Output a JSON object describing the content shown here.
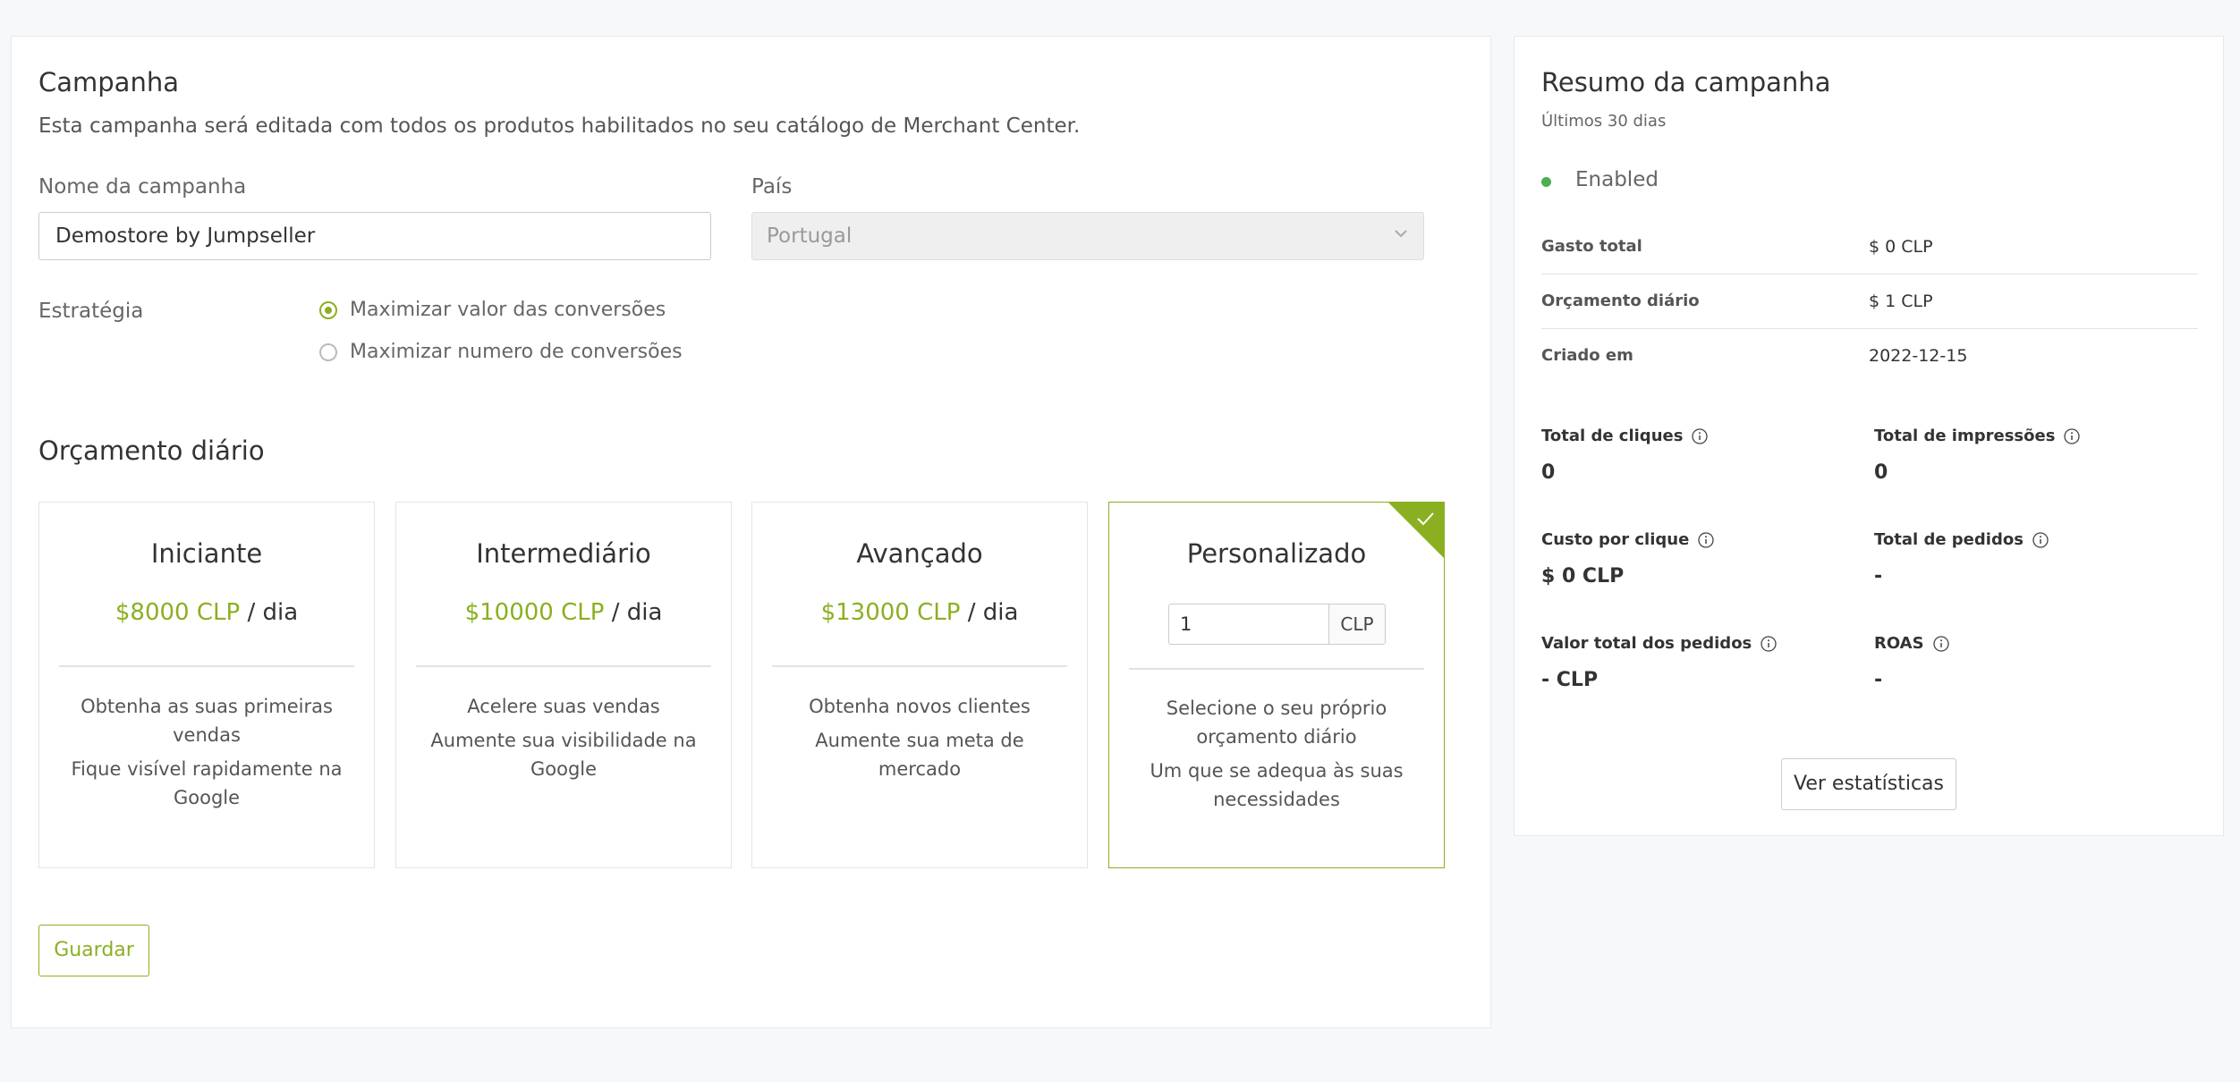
{
  "campaign": {
    "title": "Campanha",
    "description": "Esta campanha será editada com todos os produtos habilitados no seu catálogo de Merchant Center.",
    "name_label": "Nome da campanha",
    "name_value": "Demostore by Jumpseller",
    "country_label": "País",
    "country_value": "Portugal",
    "strategy_label": "Estratégia",
    "strategy_options": [
      {
        "label": "Maximizar valor das conversões",
        "selected": true
      },
      {
        "label": "Maximizar numero de conversões",
        "selected": false
      }
    ]
  },
  "budget": {
    "title": "Orçamento diário",
    "per_day": "/ dia",
    "plans": [
      {
        "name": "Iniciante",
        "amount": "$8000 CLP",
        "desc": [
          "Obtenha as suas primeiras vendas",
          "Fique visível rapidamente na Google"
        ]
      },
      {
        "name": "Intermediário",
        "amount": "$10000 CLP",
        "desc": [
          "Acelere suas vendas",
          "Aumente sua visibilidade na Google"
        ]
      },
      {
        "name": "Avançado",
        "amount": "$13000 CLP",
        "desc": [
          "Obtenha novos clientes",
          "Aumente sua meta de mercado"
        ]
      },
      {
        "name": "Personalizado",
        "input_value": "1",
        "unit": "CLP",
        "desc": [
          "Selecione o seu próprio orçamento diário",
          "Um que se adequa às suas necessidades"
        ],
        "selected": true
      }
    ],
    "save_label": "Guardar"
  },
  "summary": {
    "title": "Resumo da campanha",
    "period": "Últimos 30 dias",
    "status": "Enabled",
    "status_color": "#4caf50",
    "rows": [
      {
        "key": "Gasto total",
        "value": "$ 0 CLP"
      },
      {
        "key": "Orçamento diário",
        "value": "$ 1 CLP"
      },
      {
        "key": "Criado em",
        "value": "2022-12-15"
      }
    ],
    "stats": [
      {
        "key": "Total de cliques",
        "value": "0"
      },
      {
        "key": "Total de impressões",
        "value": "0"
      },
      {
        "key": "Custo por clique",
        "value": "$ 0 CLP"
      },
      {
        "key": "Total de pedidos",
        "value": "-"
      },
      {
        "key": "Valor total dos pedidos",
        "value": "- CLP"
      },
      {
        "key": "ROAS",
        "value": "-"
      }
    ],
    "stats_button": "Ver estatísticas"
  },
  "colors": {
    "accent": "#8ab021"
  }
}
